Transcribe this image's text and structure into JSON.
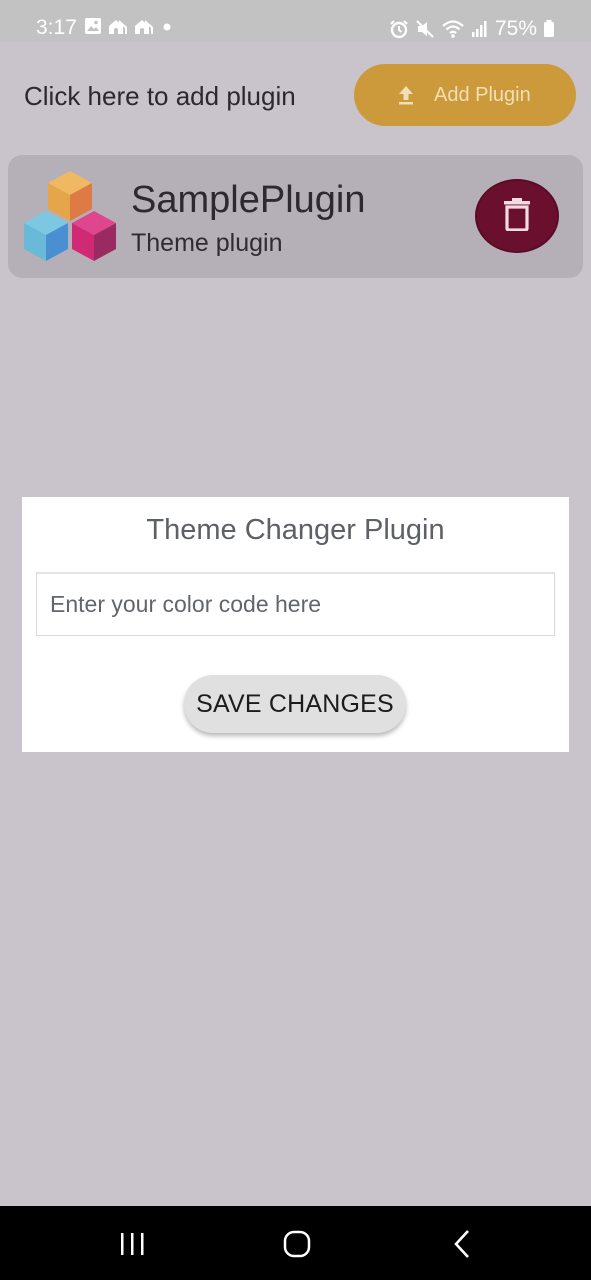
{
  "status_bar": {
    "time": "3:17",
    "battery": "75%",
    "left_icons": [
      "image-icon",
      "home-signal-icon",
      "home-signal-icon",
      "dot-icon"
    ],
    "right_icons": [
      "alarm-icon",
      "mute-icon",
      "wifi-icon",
      "signal-icon",
      "battery-icon"
    ]
  },
  "header": {
    "text": "Click here to add plugin",
    "add_button_label": "Add Plugin",
    "add_button_icon": "upload-icon",
    "add_button_color": "#cc9a3b"
  },
  "plugin_card": {
    "name": "SamplePlugin",
    "type": "Theme plugin",
    "logo_icon": "cubes-logo-icon",
    "delete_icon": "trash-icon",
    "delete_button_color": "#6b0f2e"
  },
  "dialog": {
    "title": "Theme Changer Plugin",
    "input_placeholder": "Enter your color code here",
    "input_value": "",
    "save_label": "SAVE CHANGES"
  },
  "nav_bar": {
    "buttons": [
      "recent-apps-icon",
      "home-icon",
      "back-icon"
    ]
  }
}
